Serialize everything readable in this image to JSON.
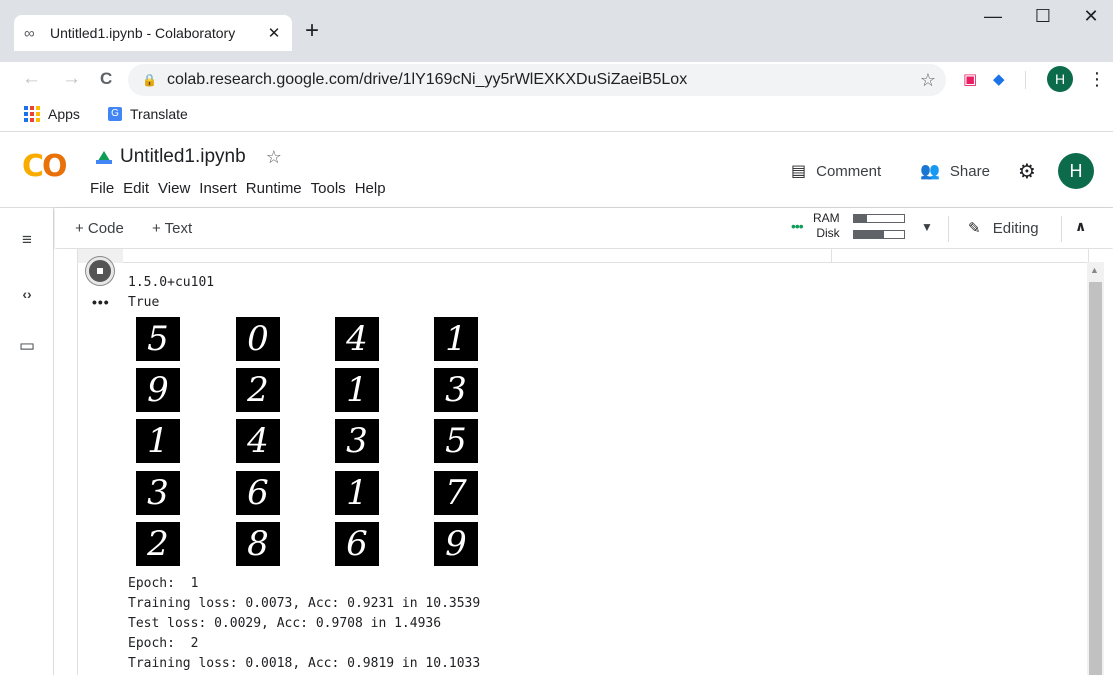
{
  "browser": {
    "tab_title": "Untitled1.ipynb - Colaboratory",
    "tab_close": "✕",
    "new_tab": "+",
    "url": "colab.research.google.com/drive/1lY169cNi_yy5rWlEXKXDuSiZaeiB5Lox",
    "profile_initial": "H",
    "window_controls": {
      "minimize": "—",
      "maximize": "☐",
      "close": "✕"
    },
    "bookmarks": [
      "Apps",
      "Translate"
    ]
  },
  "colab": {
    "notebook_title": "Untitled1.ipynb",
    "menu": [
      "File",
      "Edit",
      "View",
      "Insert",
      "Runtime",
      "Tools",
      "Help"
    ],
    "comment_label": "Comment",
    "share_label": "Share",
    "user_initial": "H"
  },
  "toolbar": {
    "add_code": "+ Code",
    "add_text": "+ Text",
    "ram_label": "RAM",
    "disk_label": "Disk",
    "ram_usage": 0.25,
    "disk_usage": 0.6,
    "editing_label": "Editing"
  },
  "output": {
    "version": "1.5.0+cu101",
    "cuda_available": "True",
    "digit_grid": [
      [
        "5",
        "0",
        "4",
        "1"
      ],
      [
        "9",
        "2",
        "1",
        "3"
      ],
      [
        "1",
        "4",
        "3",
        "5"
      ],
      [
        "3",
        "6",
        "1",
        "7"
      ],
      [
        "2",
        "8",
        "6",
        "9"
      ]
    ],
    "log": [
      "Epoch:  1",
      "Training loss: 0.0073, Acc: 0.9231 in 10.3539",
      "Test loss: 0.0029, Acc: 0.9708 in 1.4936",
      "Epoch:  2",
      "Training loss: 0.0018, Acc: 0.9819 in 10.1033"
    ]
  },
  "icons": {
    "tab_favicon": "∞",
    "back": "←",
    "forward": "→",
    "reload": "C",
    "lock": "🔒",
    "bookmark_star": "☆",
    "kebab": "⋮",
    "title_star": "☆",
    "comment": "▤",
    "share": "👥",
    "settings": "⚙",
    "toc": "≡",
    "code": "‹›",
    "files": "▭",
    "caret": "▼",
    "pencil": "✎",
    "collapse": "∧",
    "ellipsis": "•••",
    "scroll_up": "▲"
  }
}
